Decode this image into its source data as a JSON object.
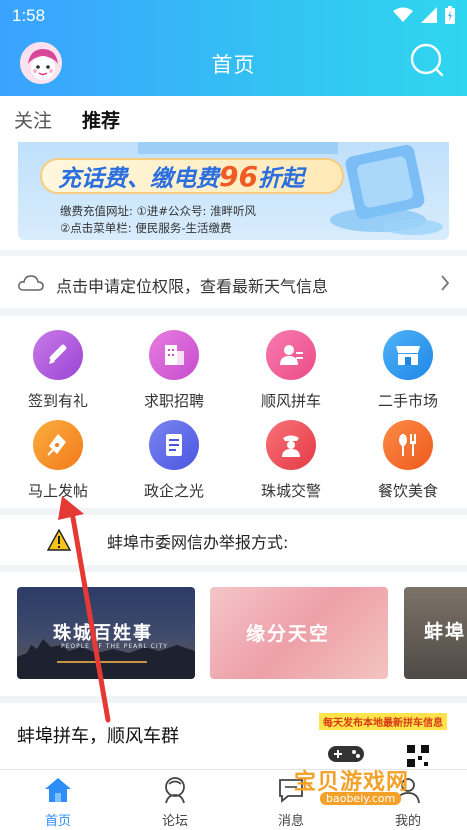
{
  "status_bar": {
    "time": "1:58"
  },
  "header": {
    "title": "首页"
  },
  "tabs": [
    {
      "label": "关注"
    },
    {
      "label": "推荐"
    }
  ],
  "banner": {
    "headline_prefix": "充话费、缴电费",
    "headline_number": "96",
    "headline_suffix": "折起",
    "line1": "缴费充值网址: ①进#公众号: 淮畔听风",
    "line2": "②点击菜单栏: 便民服务-生活缴费"
  },
  "weather": {
    "text": "点击申请定位权限，查看最新天气信息"
  },
  "grid": {
    "items": [
      {
        "label": "签到有礼",
        "icon": "pencil-icon",
        "color": "#b15be0"
      },
      {
        "label": "求职招聘",
        "icon": "building-icon",
        "color": "#d35bd8"
      },
      {
        "label": "顺风拼车",
        "icon": "person-card-icon",
        "color": "#f0609a"
      },
      {
        "label": "二手市场",
        "icon": "store-icon",
        "color": "#2f9af0"
      },
      {
        "label": "马上发帖",
        "icon": "pen-nib-icon",
        "color": "#f5861f"
      },
      {
        "label": "政企之光",
        "icon": "document-icon",
        "color": "#5a67e8"
      },
      {
        "label": "珠城交警",
        "icon": "police-icon",
        "color": "#ee4d55"
      },
      {
        "label": "餐饮美食",
        "icon": "fork-spoon-icon",
        "color": "#f56a2a"
      }
    ]
  },
  "notice": {
    "text": "蚌埠市委网信办举报方式:"
  },
  "cards": [
    {
      "title": "珠城百姓事",
      "subtitle": "PEOPLE OF THE PEARL CITY"
    },
    {
      "title": "缘分天空"
    },
    {
      "title": "蚌埠"
    }
  ],
  "group": {
    "text": "蚌埠拼车，顺风车群",
    "badge": "每天发布本地最新拼车信息"
  },
  "bottom_nav": [
    {
      "label": "首页"
    },
    {
      "label": "论坛"
    },
    {
      "label": "消息"
    },
    {
      "label": "我的"
    }
  ],
  "watermark": {
    "text": "宝贝游戏网",
    "url": "baobeiy.com"
  },
  "colors": {
    "accent": "#2d8ef7",
    "annotation_arrow": "#e53935"
  }
}
